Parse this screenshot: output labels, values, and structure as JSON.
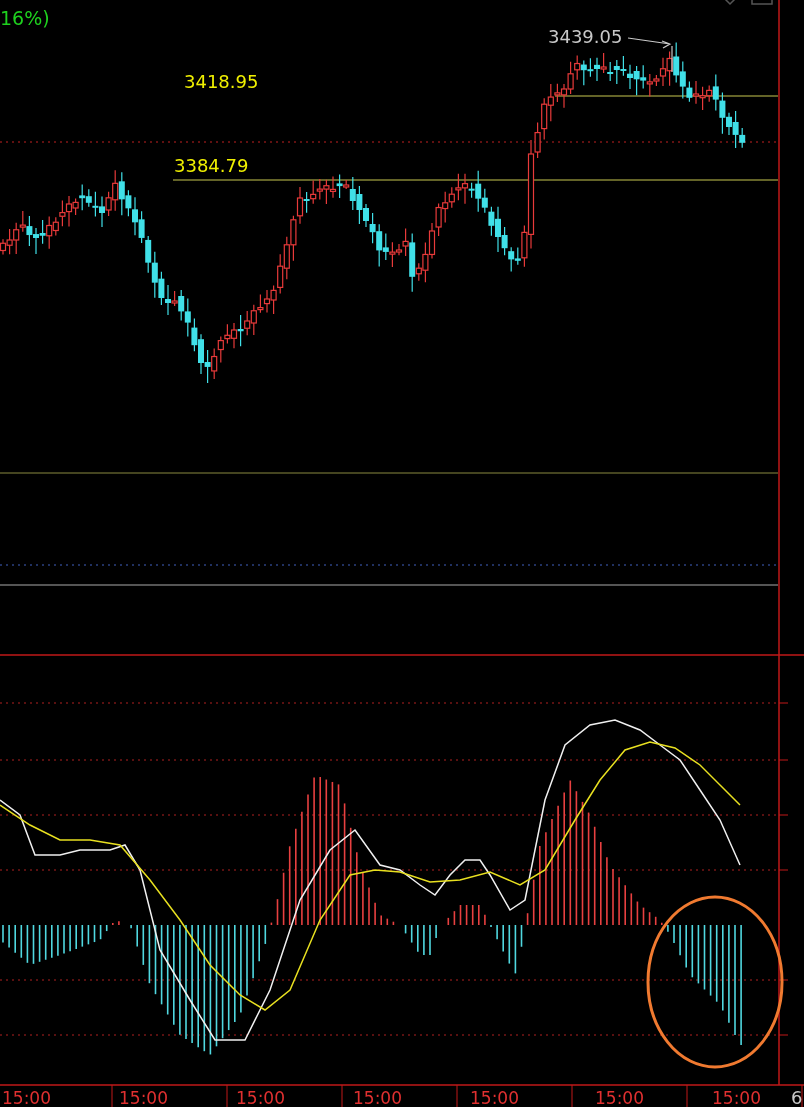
{
  "header": {
    "change_text": "16%)"
  },
  "price_chart": {
    "levels": [
      {
        "label": "3418.95"
      },
      {
        "label": "3384.79"
      }
    ],
    "high_marker": {
      "label": "3439.05"
    }
  },
  "time_axis": {
    "labels": [
      "15:00",
      "15:00",
      "15:00",
      "15:00",
      "15:00",
      "15:00",
      "15:00"
    ],
    "right_label": "6"
  }
}
